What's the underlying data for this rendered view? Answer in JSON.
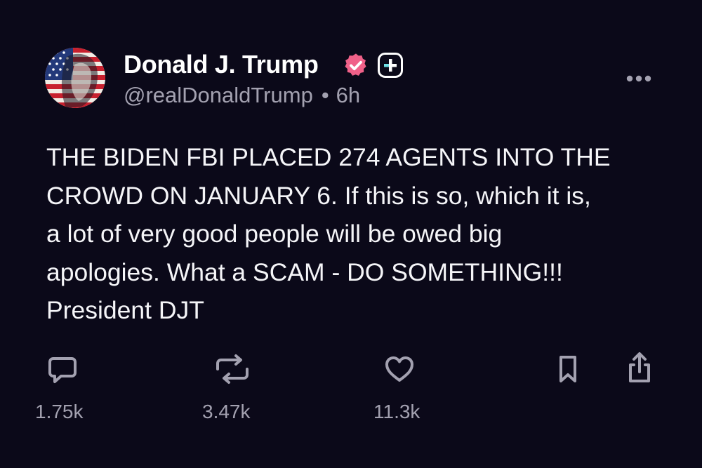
{
  "post": {
    "author": {
      "display_name": "Donald J. Trump",
      "handle": "@realDonaldTrump",
      "separator": "•",
      "time_ago": "6h",
      "verified": true
    },
    "body": "THE BIDEN FBI PLACED 274 AGENTS INTO THE\nCROWD ON JANUARY 6. If this is so, which it is,\na lot of very good people will be owed big\napologies. What a SCAM - DO SOMETHING!!!\nPresident DJT",
    "actions": {
      "replies": "1.75k",
      "reposts": "3.47k",
      "likes": "11.3k"
    },
    "icons": [
      "avatar",
      "verified-badge-icon",
      "plus-badge-icon",
      "more-icon",
      "reply-icon",
      "repost-icon",
      "like-icon",
      "bookmark-icon",
      "share-icon"
    ]
  },
  "colors": {
    "background": "#0b0919",
    "text": "#f5f5f8",
    "muted": "#a3a1b0",
    "verified": "#f06189"
  }
}
